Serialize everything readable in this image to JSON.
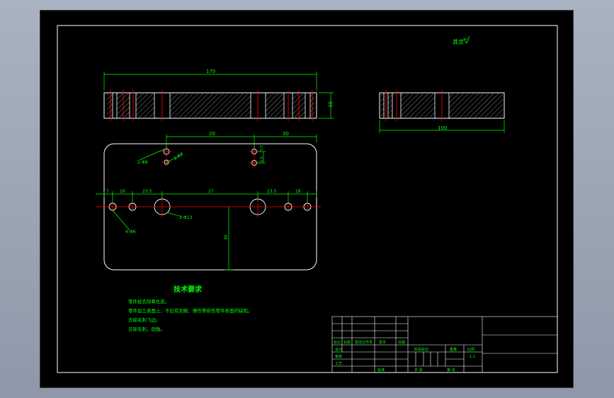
{
  "drawing": {
    "surface_symbol_label": "其余",
    "dimensions": {
      "top_length": "170",
      "top_height": "30",
      "side_width": "100",
      "plan_20": "20",
      "plan_30": "30",
      "vert_a": "5.5",
      "vert_b": "5.5",
      "hole_label_1": "2-Φ8",
      "hole_label_2": "2-Φ4",
      "row_7": "7",
      "row_16": "16",
      "row_235a": "23.5",
      "row_27": "27",
      "row_235b": "23.5",
      "row_18": "18",
      "hole_4_label": "4-Φ6",
      "big_hole_label": "2-Φ13",
      "depth_30": "30"
    },
    "tech_title": "技术要求",
    "tech_notes": [
      "零件经去除氧化皮。",
      "零件加工表面上，不应有划痕、擦伤等损伤零件表面的缺陷。",
      "去除毛刺飞边。",
      "去除毛刺，倒角。"
    ],
    "title_block": {
      "change_headers": [
        "标记",
        "处数",
        "更改文件号",
        "签字",
        "日期"
      ],
      "row_labels": [
        "设计",
        "审核",
        "工艺",
        "批准"
      ],
      "stage_headers": [
        "阶段标记",
        "重量",
        "比例"
      ],
      "scale": "1:1",
      "sheet_total": "共   张",
      "sheet_no": "第   张"
    },
    "colors": {
      "background": "#000000",
      "outline": "#ffffff",
      "dimension": "#00ff00",
      "centerline": "#ff0000",
      "hatch": "#c0c0c0"
    }
  }
}
